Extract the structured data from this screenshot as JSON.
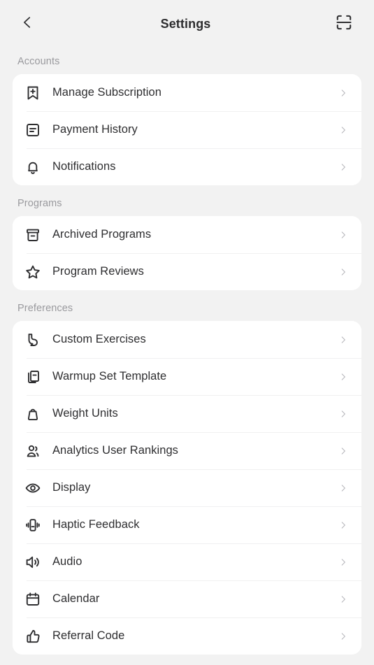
{
  "header": {
    "back_icon": "chevron-left-icon",
    "title": "Settings",
    "action_icon": "scan-barcode-icon"
  },
  "theme": {
    "page_background": "#F2F2F2",
    "card_background": "#FFFFFF",
    "label_color": "#2E2E30",
    "section_title_color": "#9A9A9E",
    "chevron_color": "#B6B6BB",
    "divider_color": "#F0F0F1"
  },
  "sections": [
    {
      "title": "Accounts",
      "items": [
        {
          "label": "Manage Subscription",
          "icon": "bookmark-plus-icon",
          "chevron": "chevron-right-icon"
        },
        {
          "label": "Payment History",
          "icon": "receipt-icon",
          "chevron": "chevron-right-icon"
        },
        {
          "label": "Notifications",
          "icon": "bell-icon",
          "chevron": "chevron-right-icon"
        }
      ]
    },
    {
      "title": "Programs",
      "items": [
        {
          "label": "Archived Programs",
          "icon": "archive-box-icon",
          "chevron": "chevron-right-icon"
        },
        {
          "label": "Program Reviews",
          "icon": "star-icon",
          "chevron": "chevron-right-icon"
        }
      ]
    },
    {
      "title": "Preferences",
      "items": [
        {
          "label": "Custom Exercises",
          "icon": "biceps-flexed-icon",
          "chevron": "chevron-right-icon"
        },
        {
          "label": "Warmup Set Template",
          "icon": "copy-layers-icon",
          "chevron": "chevron-right-icon"
        },
        {
          "label": "Weight Units",
          "icon": "weight-icon",
          "chevron": "chevron-right-icon"
        },
        {
          "label": "Analytics User Rankings",
          "icon": "users-icon",
          "chevron": "chevron-right-icon"
        },
        {
          "label": "Display",
          "icon": "eye-icon",
          "chevron": "chevron-right-icon"
        },
        {
          "label": "Haptic Feedback",
          "icon": "vibrate-icon",
          "chevron": "chevron-right-icon"
        },
        {
          "label": "Audio",
          "icon": "speaker-icon",
          "chevron": "chevron-right-icon"
        },
        {
          "label": "Calendar",
          "icon": "calendar-icon",
          "chevron": "chevron-right-icon"
        },
        {
          "label": "Referral Code",
          "icon": "thumbs-up-icon",
          "chevron": "chevron-right-icon"
        }
      ]
    }
  ]
}
